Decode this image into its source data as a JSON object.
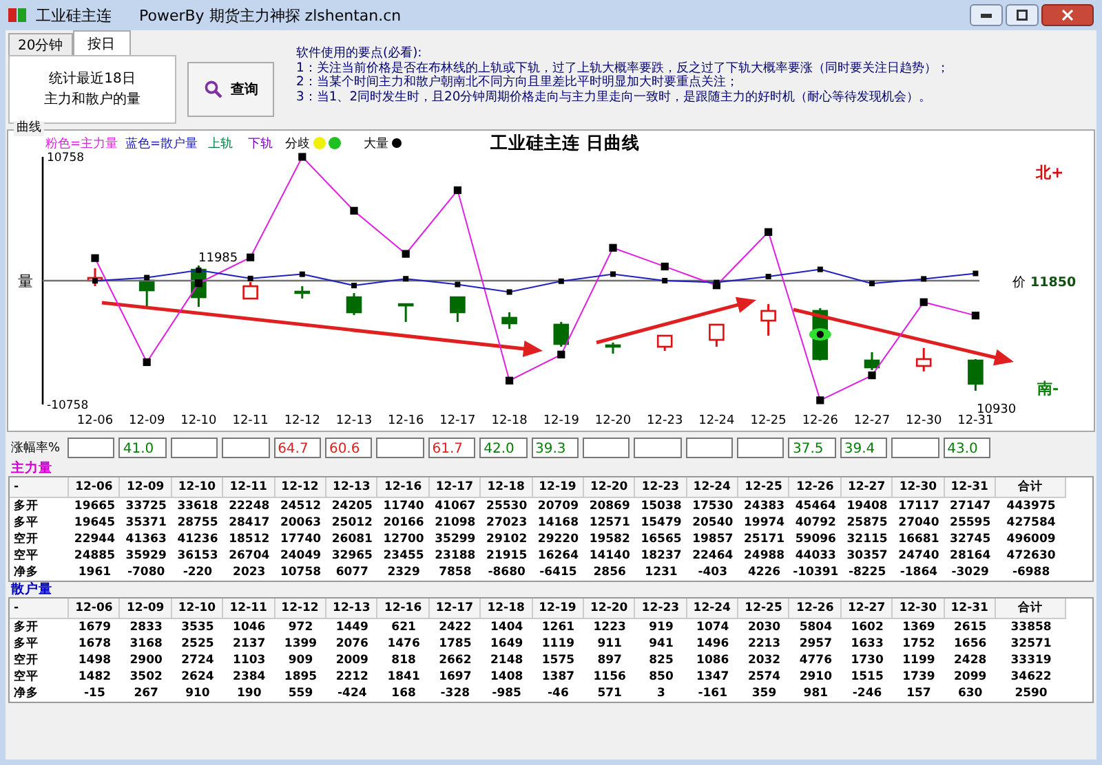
{
  "window": {
    "title": "工业硅主连",
    "subtitle": "PowerBy 期货主力神探 zlshentan.cn"
  },
  "tabs": [
    {
      "label": "20分钟",
      "selected": false
    },
    {
      "label": "按日",
      "selected": true
    }
  ],
  "stats_panel": {
    "lines": [
      "统计最近18日",
      "主力和散户的量"
    ]
  },
  "query_button": "查询",
  "notes": {
    "heading": "软件使用的要点(必看):",
    "lines": [
      "1：关注当前价格是否在布林线的上轨或下轨，过了上轨大概率要跌，反之过了下轨大概率要涨（同时要关注日趋势）；",
      "2：当某个时间主力和散户朝南北不同方向且里差比平时明显加大时要重点关注；",
      "3：当1、2同时发生时，且20分钟周期价格走向与主力里走向一致时，是跟随主力的好时机（耐心等待发现机会）。"
    ]
  },
  "chart": {
    "group_label": "曲线",
    "title": "工业硅主连 日曲线",
    "legend": [
      {
        "label": "粉色=主力量",
        "color": "#e020e0",
        "kind": "text"
      },
      {
        "label": "蓝色=散户量",
        "color": "#2020c0",
        "kind": "text"
      },
      {
        "label": "上轨",
        "color": "#008040",
        "kind": "text"
      },
      {
        "label": "下轨",
        "color": "#8000c0",
        "kind": "text"
      },
      {
        "label": "分歧",
        "color": "#000000",
        "kind": "divergence"
      },
      {
        "label": "大量",
        "color": "#000000",
        "kind": "big"
      }
    ],
    "y_label": "量",
    "price_label": "价",
    "price_value": "11850",
    "north_label": "北+",
    "south_label": "南-",
    "high_label": "11985",
    "low_label": "10930",
    "chart_data": {
      "type": "line",
      "series": [
        {
          "color": "#e020e0",
          "marker": "square",
          "values": [
            1961,
            -7080,
            -220,
            2023,
            10758,
            6077,
            2329,
            7858,
            -8680,
            -6415,
            2856,
            1231,
            -403,
            4226,
            -10391,
            -8225,
            -1864,
            -3029
          ]
        },
        {
          "color": "#2020c0",
          "marker": "square",
          "values": [
            -15,
            267,
            910,
            190,
            559,
            -424,
            168,
            -328,
            -985,
            -46,
            571,
            3,
            -161,
            359,
            981,
            -246,
            157,
            630
          ]
        }
      ],
      "ylim": [
        -10758,
        10758
      ],
      "yticks": [
        10758,
        -10758
      ]
    },
    "price_chart": {
      "chart_data": {
        "type": "candlestick",
        "categories": [
          "12-06",
          "12-09",
          "12-10",
          "12-11",
          "12-12",
          "12-13",
          "12-16",
          "12-17",
          "12-18",
          "12-19",
          "12-20",
          "12-23",
          "12-24",
          "12-25",
          "12-26",
          "12-27",
          "12-30",
          "12-31"
        ],
        "ohlc": [
          [
            11858,
            11962,
            11811,
            11881
          ],
          [
            11858,
            11858,
            11637,
            11776
          ],
          [
            11950,
            11985,
            11637,
            11718
          ],
          [
            11707,
            11846,
            11707,
            11811
          ],
          [
            11765,
            11811,
            11707,
            11758
          ],
          [
            11718,
            11753,
            11568,
            11591
          ],
          [
            11660,
            11660,
            11510,
            11649
          ],
          [
            11718,
            11718,
            11510,
            11591
          ],
          [
            11545,
            11591,
            11452,
            11498
          ],
          [
            11487,
            11510,
            11301,
            11324
          ],
          [
            11313,
            11336,
            11243,
            11301
          ],
          [
            11301,
            11394,
            11266,
            11394
          ],
          [
            11359,
            11487,
            11301,
            11487
          ],
          [
            11521,
            11660,
            11394,
            11603
          ],
          [
            11603,
            11626,
            11185,
            11197
          ],
          [
            11185,
            11255,
            11104,
            11127
          ],
          [
            11139,
            11290,
            11093,
            11197
          ],
          [
            11185,
            11197,
            10930,
            10989
          ]
        ]
      }
    }
  },
  "rates": {
    "label": "涨幅率%",
    "boxes": [
      {
        "kind": "empty"
      },
      {
        "kind": "value",
        "value": "41.0",
        "color": "#008000"
      },
      {
        "kind": "empty"
      },
      {
        "kind": "empty"
      },
      {
        "kind": "value",
        "value": "64.7",
        "color": "#e02020"
      },
      {
        "kind": "value",
        "value": "60.6",
        "color": "#e02020"
      },
      {
        "kind": "empty"
      },
      {
        "kind": "value",
        "value": "61.7",
        "color": "#e02020"
      },
      {
        "kind": "value",
        "value": "42.0",
        "color": "#008000"
      },
      {
        "kind": "value",
        "value": "39.3",
        "color": "#008000"
      },
      {
        "kind": "empty"
      },
      {
        "kind": "empty"
      },
      {
        "kind": "empty"
      },
      {
        "kind": "empty"
      },
      {
        "kind": "value",
        "value": "37.5",
        "color": "#008000"
      },
      {
        "kind": "value",
        "value": "39.4",
        "color": "#008000"
      },
      {
        "kind": "empty"
      },
      {
        "kind": "value",
        "value": "43.0",
        "color": "#008000"
      }
    ]
  },
  "tables": [
    {
      "title": "主力量",
      "color": "#d000d0",
      "columns": [
        "-",
        "12-06",
        "12-09",
        "12-10",
        "12-11",
        "12-12",
        "12-13",
        "12-16",
        "12-17",
        "12-18",
        "12-19",
        "12-20",
        "12-23",
        "12-24",
        "12-25",
        "12-26",
        "12-27",
        "12-30",
        "12-31",
        "合计"
      ],
      "rows": [
        [
          "多开",
          "19665",
          "33725",
          "33618",
          "22248",
          "24512",
          "24205",
          "11740",
          "41067",
          "25530",
          "20709",
          "20869",
          "15038",
          "17530",
          "24383",
          "45464",
          "19408",
          "17117",
          "27147",
          "443975"
        ],
        [
          "多平",
          "19645",
          "35371",
          "28755",
          "28417",
          "20063",
          "25012",
          "20166",
          "21098",
          "27023",
          "14168",
          "12571",
          "15479",
          "20540",
          "19974",
          "40792",
          "25875",
          "27040",
          "25595",
          "427584"
        ],
        [
          "空开",
          "22944",
          "41363",
          "41236",
          "18512",
          "17740",
          "26081",
          "12700",
          "35299",
          "29102",
          "29220",
          "19582",
          "16565",
          "19857",
          "25171",
          "59096",
          "32115",
          "16681",
          "32745",
          "496009"
        ],
        [
          "空平",
          "24885",
          "35929",
          "36153",
          "26704",
          "24049",
          "32965",
          "23455",
          "23188",
          "21915",
          "16264",
          "14140",
          "18237",
          "22464",
          "24988",
          "44033",
          "30357",
          "24740",
          "28164",
          "472630"
        ],
        [
          "净多",
          "1961",
          "-7080",
          "-220",
          "2023",
          "10758",
          "6077",
          "2329",
          "7858",
          "-8680",
          "-6415",
          "2856",
          "1231",
          "-403",
          "4226",
          "-10391",
          "-8225",
          "-1864",
          "-3029",
          "-6988"
        ]
      ]
    },
    {
      "title": "散户量",
      "color": "#0000c0",
      "columns": [
        "-",
        "12-06",
        "12-09",
        "12-10",
        "12-11",
        "12-12",
        "12-13",
        "12-16",
        "12-17",
        "12-18",
        "12-19",
        "12-20",
        "12-23",
        "12-24",
        "12-25",
        "12-26",
        "12-27",
        "12-30",
        "12-31",
        "合计"
      ],
      "rows": [
        [
          "多开",
          "1679",
          "2833",
          "3535",
          "1046",
          "972",
          "1449",
          "621",
          "2422",
          "1404",
          "1261",
          "1223",
          "919",
          "1074",
          "2030",
          "5804",
          "1602",
          "1369",
          "2615",
          "33858"
        ],
        [
          "多平",
          "1678",
          "3168",
          "2525",
          "2137",
          "1399",
          "2076",
          "1476",
          "1785",
          "1649",
          "1119",
          "911",
          "941",
          "1496",
          "2213",
          "2957",
          "1633",
          "1752",
          "1656",
          "32571"
        ],
        [
          "空开",
          "1498",
          "2900",
          "2724",
          "1103",
          "909",
          "2009",
          "818",
          "2662",
          "2148",
          "1575",
          "897",
          "825",
          "1086",
          "2032",
          "4776",
          "1730",
          "1199",
          "2428",
          "33319"
        ],
        [
          "空平",
          "1482",
          "3502",
          "2624",
          "2384",
          "1895",
          "2212",
          "1841",
          "1697",
          "1408",
          "1387",
          "1156",
          "850",
          "1347",
          "2574",
          "2910",
          "1515",
          "1739",
          "2099",
          "34622"
        ],
        [
          "净多",
          "-15",
          "267",
          "910",
          "190",
          "559",
          "-424",
          "168",
          "-328",
          "-985",
          "-46",
          "571",
          "3",
          "-161",
          "359",
          "981",
          "-246",
          "157",
          "630",
          "2590"
        ]
      ]
    }
  ]
}
